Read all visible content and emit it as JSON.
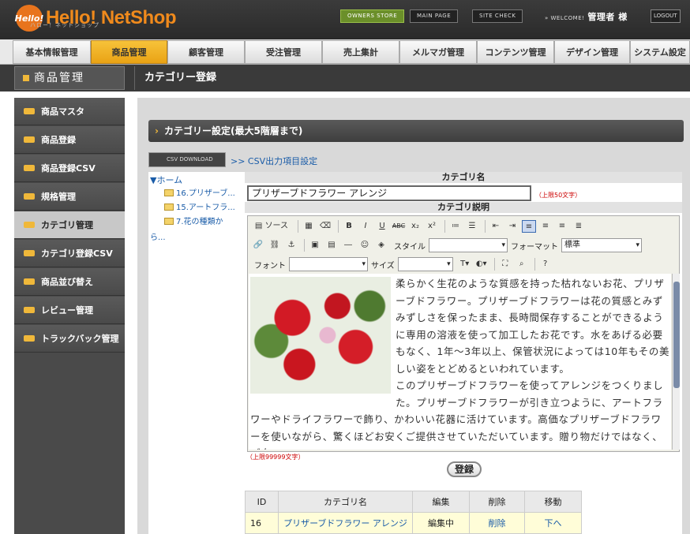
{
  "app": {
    "logo_badge": "Hello!",
    "logo_text": "Hello! NetShop",
    "logo_subtext": "ハロー！ネットショップ"
  },
  "header": {
    "owners_store": "OWNERS STORE",
    "main_page": "MAIN PAGE",
    "site_check": "SITE CHECK",
    "welcome": "» WELCOME!",
    "user": "管理者 様",
    "logout": "LOGOUT"
  },
  "global_nav": [
    "基本情報管理",
    "商品管理",
    "顧客管理",
    "受注管理",
    "売上集計",
    "メルマガ管理",
    "コンテンツ管理",
    "デザイン管理",
    "システム設定"
  ],
  "section_title": "商品管理",
  "page_title": "カテゴリー登録",
  "sidebar": [
    "商品マスタ",
    "商品登録",
    "商品登録CSV",
    "規格管理",
    "カテゴリ管理",
    "カテゴリ登録CSV",
    "商品並び替え",
    "レビュー管理",
    "トラックバック管理"
  ],
  "panel_title": "カテゴリー設定(最大5階層まで)",
  "csv_download": "CSV DOWNLOAD",
  "csv_settings": ">> CSV出力項目設定",
  "tree": {
    "root": "▼ホーム",
    "nodes": [
      "16.プリザーブ...",
      "15.アートフラ...",
      "7.花の種類か"
    ],
    "more": "ら..."
  },
  "form": {
    "name_label": "カテゴリ名",
    "name_value": "プリザーブドフラワー アレンジ",
    "name_hint": "（上限50文字）",
    "desc_label": "カテゴリ説明",
    "desc_hint": "（上限99999文字）",
    "toolbar": {
      "source": "ソース",
      "style": "スタイル",
      "format": "フォーマット",
      "format_value": "標準",
      "font": "フォント",
      "size": "サイズ"
    },
    "desc_text_1": "柔らかく生花のような質感を持った枯れないお花、プリザーブドフラワー。プリザーブドフラワーは花の質感とみずみずしさを保ったまま、長時間保存することができるように専用の溶液を使って加工したお花です。水をあげる必要もなく、1年〜3年以上、保管状況によっては10年もその美しい姿をとどめるといわれています。",
    "desc_text_2": "このプリザーブドフラワーを使ってアレンジをつくりました。プリザーブドフラワーが引き立つように、アートフラワーやドライフラワーで飾り、かわいい花器に活けています。高価なプリザーブドフラワーを使いながら、驚くほどお安くご提供させていただいています。贈り物だけではなく、ご自",
    "register": "登録"
  },
  "table": {
    "headers": [
      "ID",
      "カテゴリ名",
      "編集",
      "削除",
      "移動"
    ],
    "rows": [
      [
        "16",
        "プリザーブドフラワー アレンジ",
        "編集中",
        "削除",
        "下へ"
      ]
    ]
  }
}
